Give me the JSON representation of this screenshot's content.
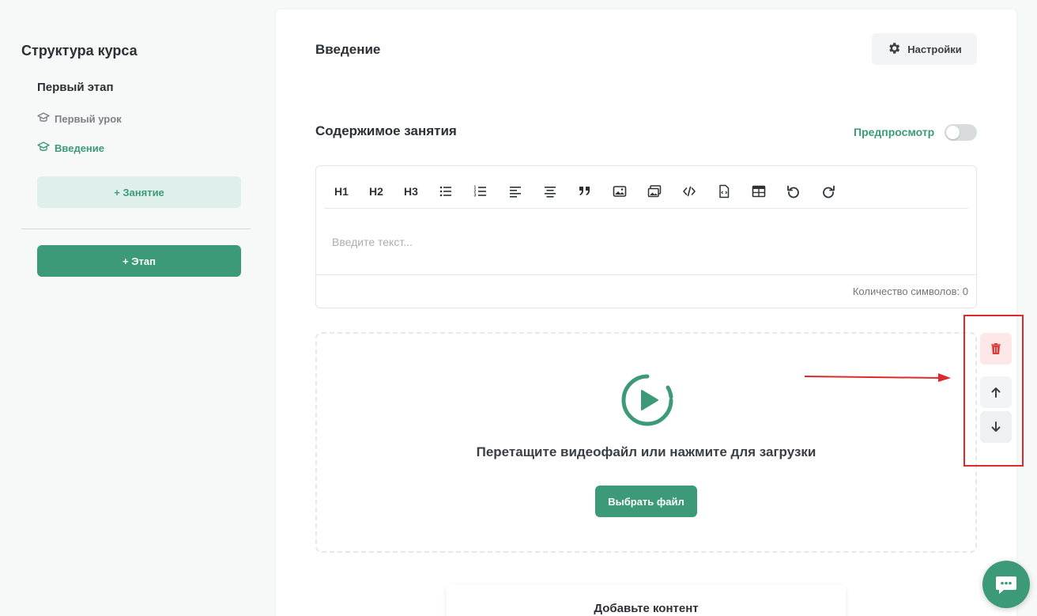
{
  "sidebar": {
    "title": "Структура курса",
    "stage_name": "Первый этап",
    "lessons": [
      {
        "label": "Первый урок"
      },
      {
        "label": "Введение"
      }
    ],
    "add_lesson_label": "+ Занятие",
    "add_stage_label": "+ Этап"
  },
  "main": {
    "title": "Введение",
    "settings_label": "Настройки",
    "content_title": "Содержимое занятия",
    "preview_label": "Предпросмотр",
    "preview_enabled": false
  },
  "editor": {
    "toolbar": {
      "h1": "H1",
      "h2": "H2",
      "h3": "H3",
      "icons": [
        "bullet-list-icon",
        "numbered-list-icon",
        "align-left-icon",
        "align-center-icon",
        "quote-icon",
        "image-icon",
        "gallery-icon",
        "code-icon",
        "file-code-icon",
        "table-icon",
        "undo-icon",
        "redo-icon"
      ]
    },
    "placeholder": "Введите текст...",
    "char_count": "Количество символов: 0"
  },
  "upload": {
    "text": "Перетащите видеофайл или нажмите для загрузки",
    "button_label": "Выбрать файл"
  },
  "add_content": {
    "title": "Добавьте контент"
  },
  "colors": {
    "accent": "#3c9a78",
    "accent_light": "#dff0ec",
    "danger": "#e53935",
    "annotation": "#dd2a2a"
  }
}
